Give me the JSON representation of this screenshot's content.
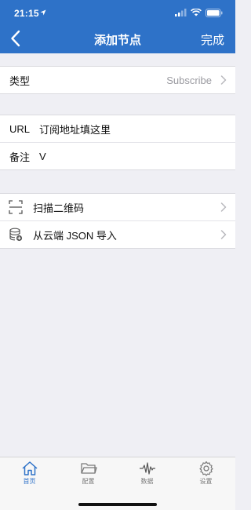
{
  "status": {
    "time": "21:15"
  },
  "nav": {
    "title": "添加节点",
    "done_label": "完成"
  },
  "type_row": {
    "label": "类型",
    "value": "Subscribe"
  },
  "url_row": {
    "label": "URL",
    "value": "订阅地址填这里"
  },
  "note_row": {
    "label": "备注",
    "value": "V"
  },
  "actions": {
    "scan_label": "扫描二维码",
    "cloud_label": "从云端 JSON 导入"
  },
  "tabs": [
    {
      "label": "首页",
      "icon": "home-icon",
      "active": true
    },
    {
      "label": "配置",
      "icon": "folder-icon",
      "active": false
    },
    {
      "label": "数据",
      "icon": "waveform-icon",
      "active": false
    },
    {
      "label": "设置",
      "icon": "gear-icon",
      "active": false
    }
  ],
  "colors": {
    "accent": "#2e72c8",
    "background": "#efeff4"
  }
}
